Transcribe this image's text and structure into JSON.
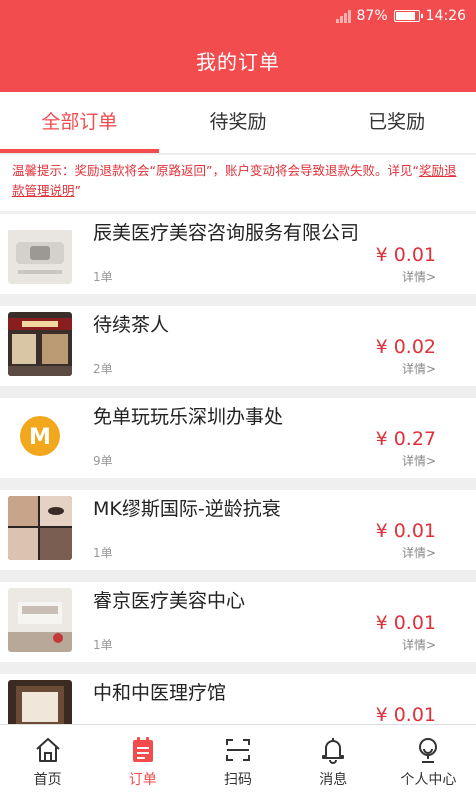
{
  "status_bar": {
    "battery": "87%",
    "time": "14:26",
    "battery_level": 0.87
  },
  "header": {
    "title": "我的订单"
  },
  "tabs": [
    {
      "label": "全部订单",
      "active": true
    },
    {
      "label": "待奖励",
      "active": false
    },
    {
      "label": "已奖励",
      "active": false
    }
  ],
  "notice": {
    "text": "温馨提示：奖励退款将会“原路返回”，账户变动将会导致退款失败。详见“",
    "link": "奖励退款管理说明",
    "suffix": "”"
  },
  "orders": [
    {
      "name": "辰美医疗美容咨询服务有限公司",
      "count": "1单",
      "price": "¥ 0.01",
      "detail": "详情>",
      "icon": "device-photo"
    },
    {
      "name": "待续茶人",
      "count": "2单",
      "price": "¥ 0.02",
      "detail": "详情>",
      "icon": "shopfront-photo"
    },
    {
      "name": "免单玩玩乐深圳办事处",
      "count": "9单",
      "price": "¥ 0.27",
      "detail": "详情>",
      "icon": "m-logo",
      "logo_text": "M"
    },
    {
      "name": "MK缪斯国际-逆龄抗衰",
      "count": "1单",
      "price": "¥ 0.01",
      "detail": "详情>",
      "icon": "beauty-photo"
    },
    {
      "name": "睿京医疗美容中心",
      "count": "1单",
      "price": "¥ 0.01",
      "detail": "详情>",
      "icon": "lobby-photo"
    },
    {
      "name": "中和中医理疗馆",
      "count": "",
      "price": "¥ 0.01",
      "detail": "",
      "icon": "room-photo"
    }
  ],
  "bottom_nav": [
    {
      "label": "首页",
      "icon": "home-icon",
      "active": false
    },
    {
      "label": "订单",
      "icon": "orders-icon",
      "active": true
    },
    {
      "label": "扫码",
      "icon": "scan-icon",
      "active": false
    },
    {
      "label": "消息",
      "icon": "bell-icon",
      "active": false
    },
    {
      "label": "个人中心",
      "icon": "profile-icon",
      "active": false
    }
  ],
  "colors": {
    "accent": "#f24c4f",
    "price": "#e0313a"
  }
}
